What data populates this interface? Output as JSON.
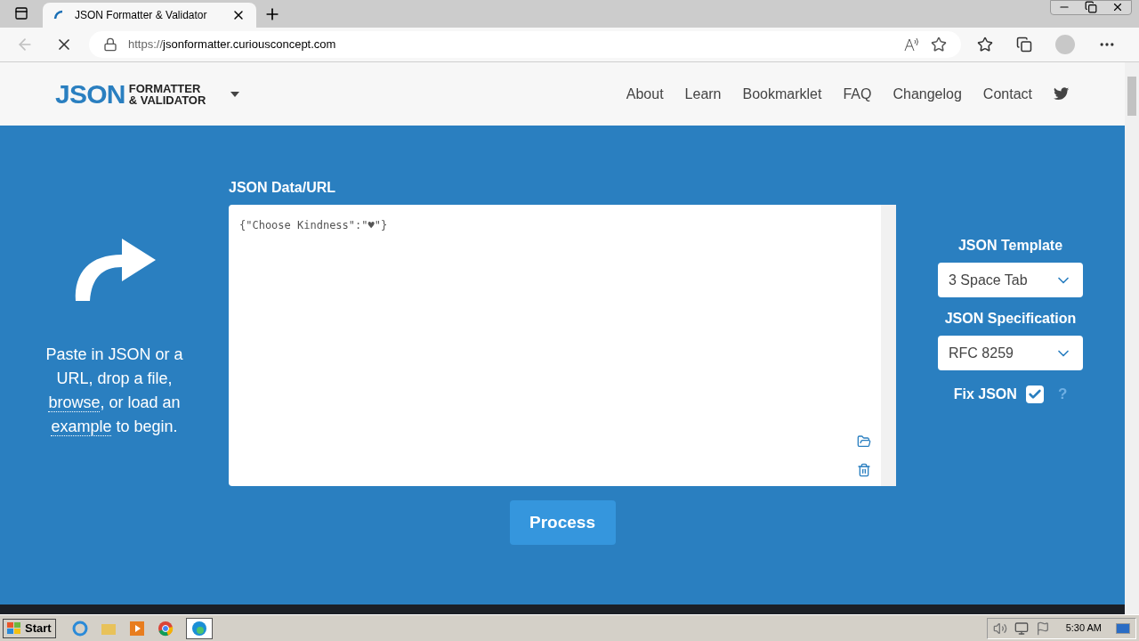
{
  "browser": {
    "tab_title": "JSON Formatter & Validator",
    "url_scheme": "https://",
    "url_host": "jsonformatter.curiousconcept.com"
  },
  "header": {
    "logo_big": "JSON",
    "logo_top": "FORMATTER",
    "logo_bottom": "& VALIDATOR",
    "nav": [
      "About",
      "Learn",
      "Bookmarklet",
      "FAQ",
      "Changelog",
      "Contact"
    ]
  },
  "intro": {
    "before": "Paste in JSON or a URL, drop a file,",
    "link1": "browse",
    "middle": ", or load an",
    "link2": "example",
    "after": "to begin."
  },
  "editor": {
    "label": "JSON Data/URL",
    "value": "{\"Choose Kindness\":\"♥\"}"
  },
  "options": [
    {
      "label": "JSON Template",
      "value": "3 Space Tab"
    },
    {
      "label": "JSON Specification",
      "value": "RFC 8259"
    }
  ],
  "fix_json": {
    "label": "Fix JSON",
    "checked": true,
    "help": "?"
  },
  "process_button": "Process",
  "taskbar": {
    "start": "Start",
    "time": "5:30 AM"
  }
}
